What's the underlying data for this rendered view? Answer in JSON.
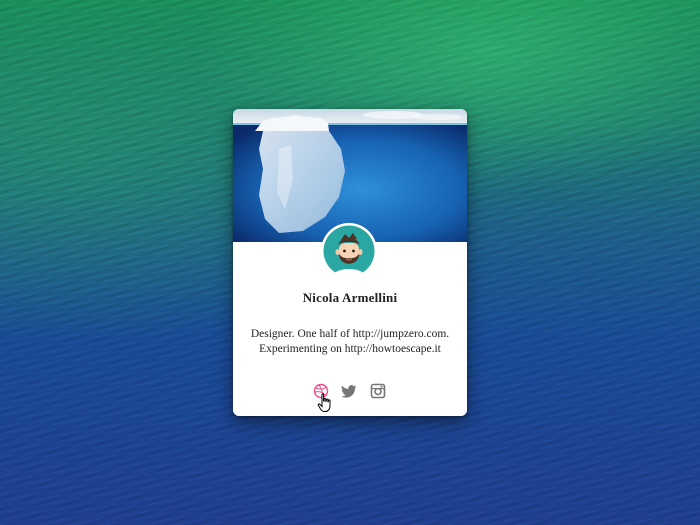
{
  "profile": {
    "name": "Nicola Armellini",
    "bio_line1": "Designer. One half of http://jumpzero.com.",
    "bio_line2": "Experimenting on http://howtoescape.it"
  },
  "social": [
    {
      "icon": "dribbble-icon",
      "color": "#ea4c89"
    },
    {
      "icon": "twitter-icon",
      "color": "#777777"
    },
    {
      "icon": "instagram-icon",
      "color": "#777777"
    }
  ],
  "colors": {
    "avatar_bg": "#2aa7a3",
    "card_bg": "#ffffff"
  }
}
